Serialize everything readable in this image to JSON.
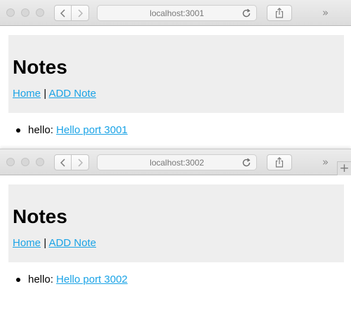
{
  "windows": [
    {
      "url": "localhost:3001",
      "title": "Notes",
      "nav": {
        "home": "Home",
        "separator": "|",
        "add_note": "ADD Note"
      },
      "notes": [
        {
          "label": "hello:",
          "link": "Hello port 3001"
        }
      ]
    },
    {
      "url": "localhost:3002",
      "title": "Notes",
      "nav": {
        "home": "Home",
        "separator": "|",
        "add_note": "ADD Note"
      },
      "notes": [
        {
          "label": "hello:",
          "link": "Hello port 3002"
        }
      ]
    }
  ],
  "toolbar": {
    "overflow": "»",
    "new_tab": "+"
  },
  "icons": {
    "back": "chevron-left-icon",
    "forward": "chevron-right-icon",
    "reload": "reload-icon",
    "share": "share-icon"
  },
  "colors": {
    "link": "#1aa3e6",
    "header_bg": "#eeeeee"
  }
}
